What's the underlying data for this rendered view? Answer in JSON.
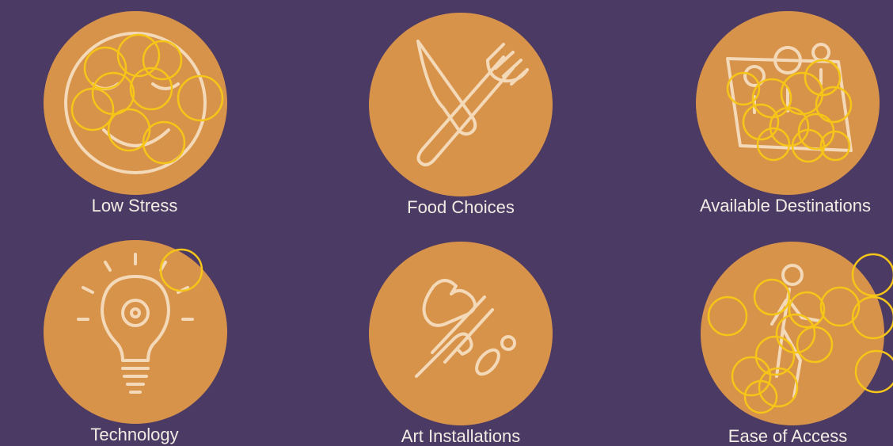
{
  "features": [
    {
      "label": "Low Stress",
      "icon": "smiley-face-icon"
    },
    {
      "label": "Food Choices",
      "icon": "knife-fork-icon"
    },
    {
      "label": "Available Destinations",
      "icon": "map-pins-icon"
    },
    {
      "label": "Technology",
      "icon": "lightbulb-gear-icon"
    },
    {
      "label": "Art Installations",
      "icon": "paintbrush-strokes-icon"
    },
    {
      "label": "Ease of Access",
      "icon": "walking-person-icon"
    }
  ],
  "colors": {
    "background": "#4b3a64",
    "circle": "#d8934a",
    "icon_stroke": "#f3d9b8",
    "annotation": "#f5c518",
    "label_text": "#f2ece4"
  }
}
